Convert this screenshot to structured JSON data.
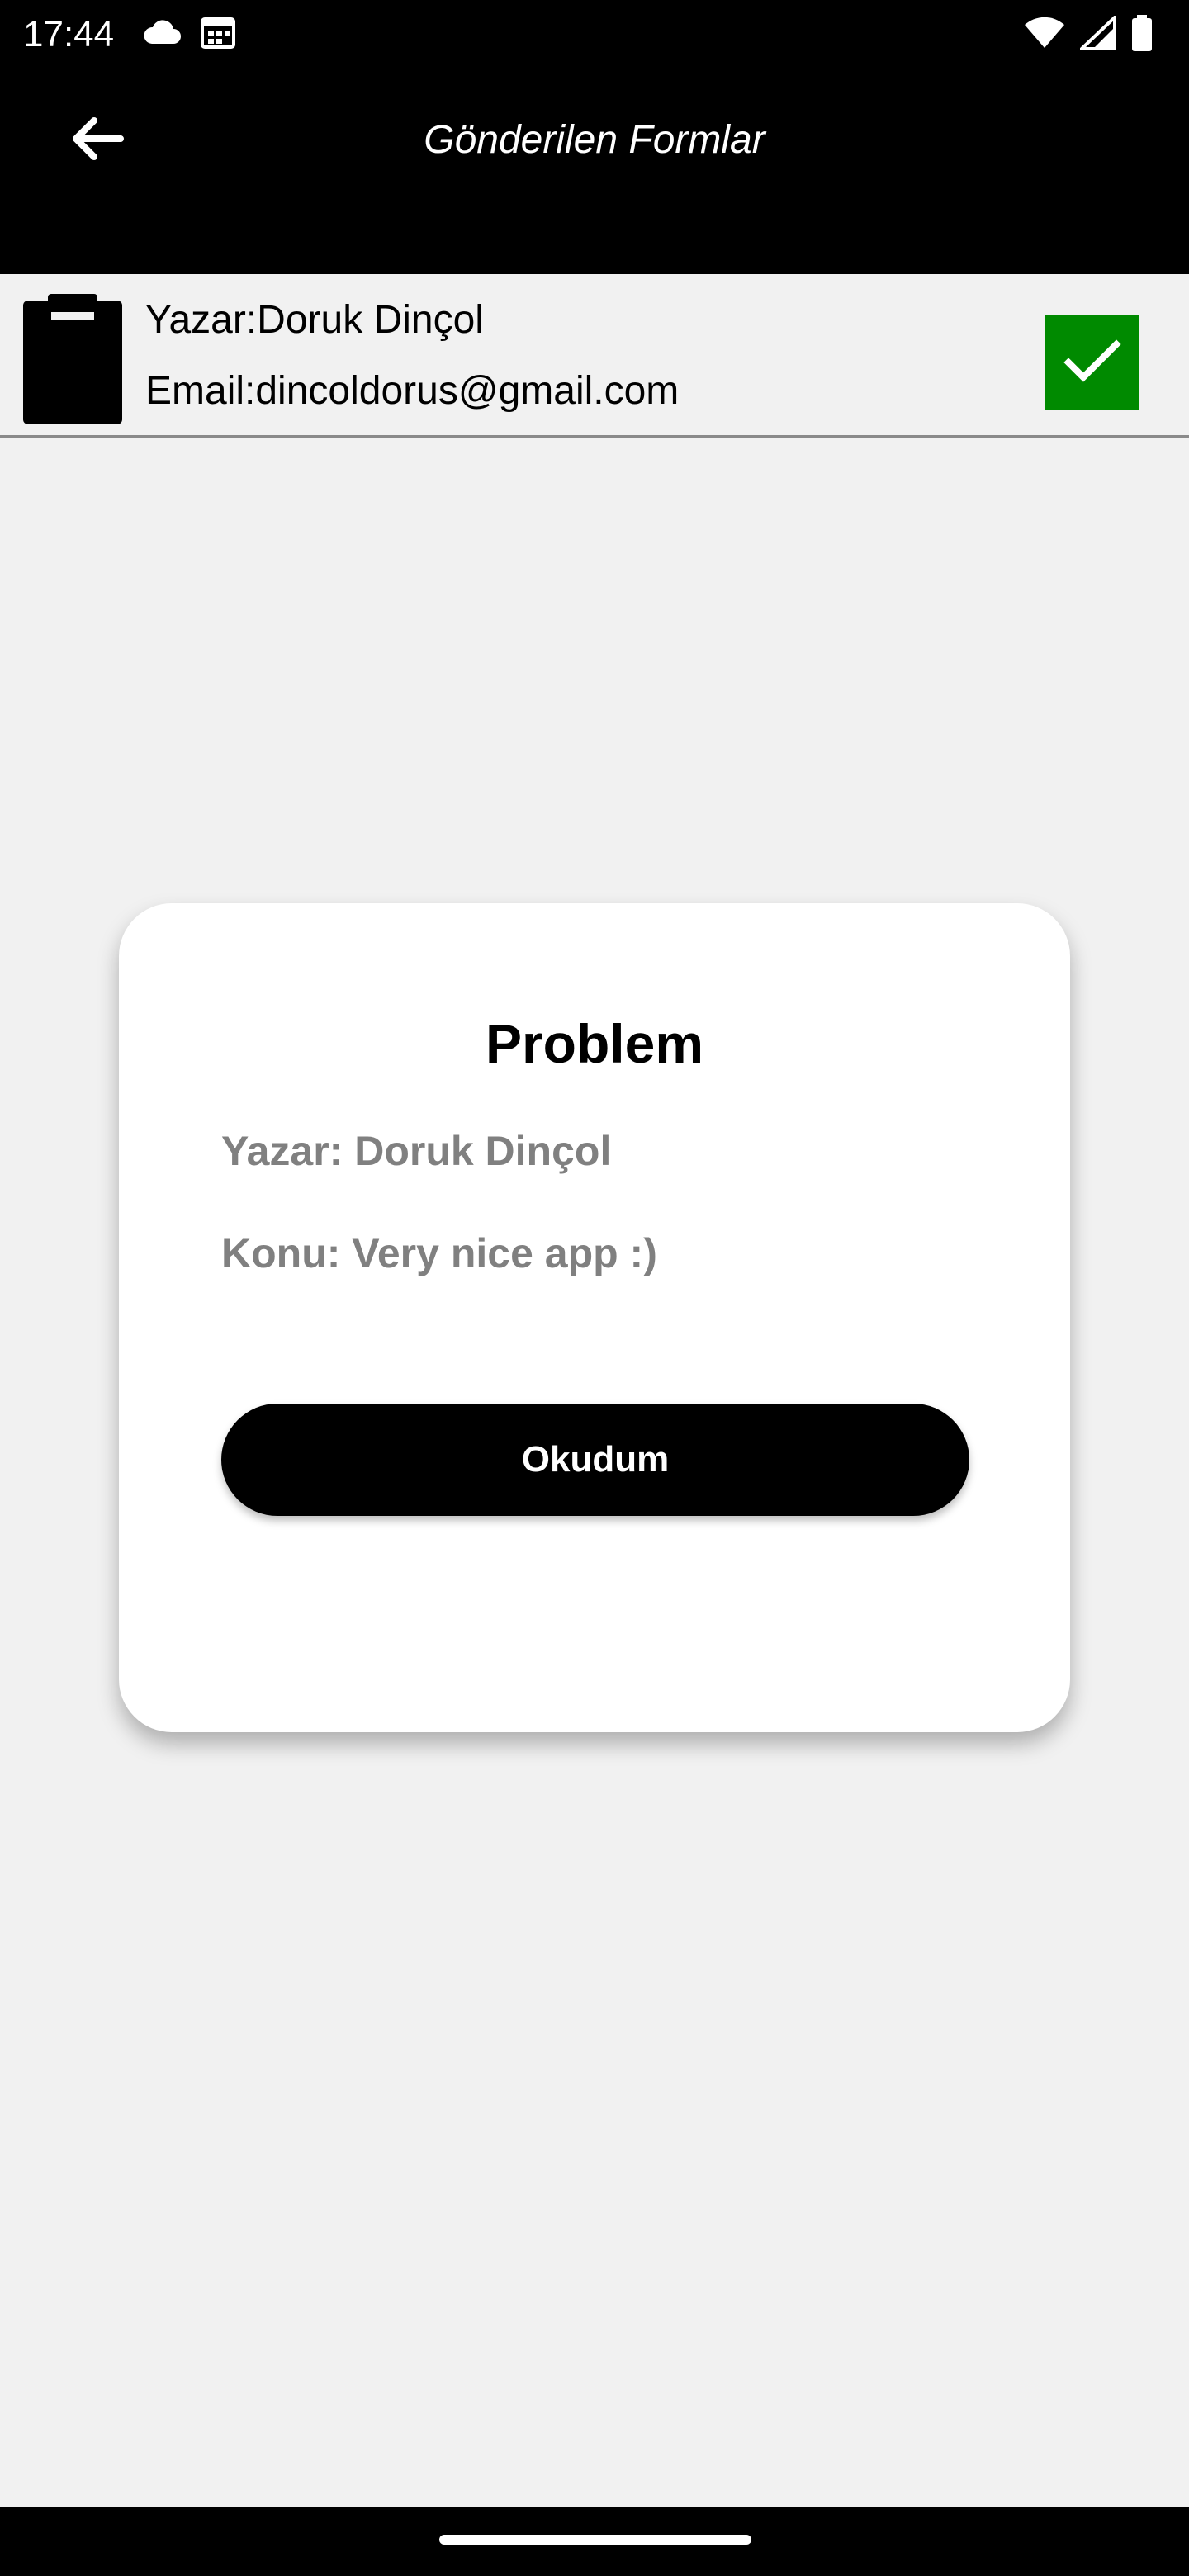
{
  "status_bar": {
    "time": "17:44",
    "left_icons": [
      "cloud-icon",
      "calendar-icon"
    ],
    "right_icons": [
      "wifi-icon",
      "signal-icon",
      "battery-icon"
    ]
  },
  "app_bar": {
    "back_icon": "arrow-left-icon",
    "title": "Gönderilen Formlar"
  },
  "form_list": {
    "items": [
      {
        "icon": "clipboard-icon",
        "author": "Yazar:Doruk Dinçol",
        "email": "Email:dincoldorus@gmail.com",
        "status_icon": "checkmark-icon",
        "status_color": "#008a00"
      }
    ]
  },
  "dialog": {
    "title": "Problem",
    "author": "Yazar: Doruk Dinçol",
    "subject": "Konu: Very nice app :)",
    "button_label": "Okudum"
  },
  "colors": {
    "background": "#f1f1f1",
    "app_bar": "#000000",
    "accent_green": "#008a00",
    "muted_text": "#808080"
  }
}
